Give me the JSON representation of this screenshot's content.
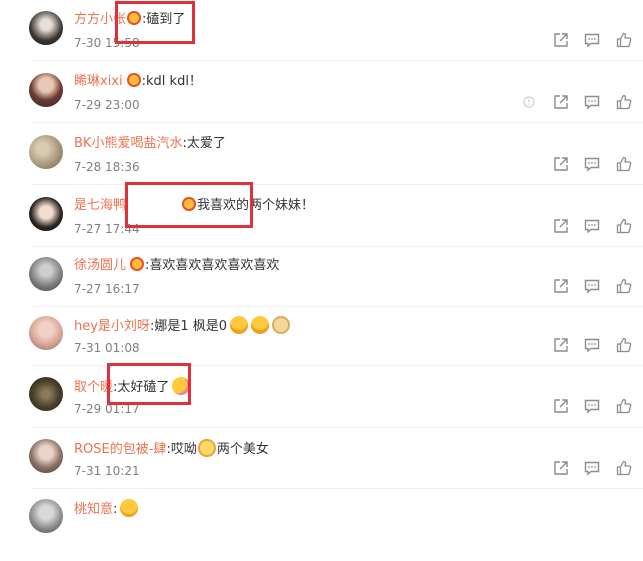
{
  "colors": {
    "username": "#eb7350",
    "text": "#333333",
    "time": "#808080",
    "highlight_box": "#e0303a"
  },
  "action_icons": [
    "share-icon",
    "comment-icon",
    "like-icon"
  ],
  "comments": [
    {
      "username": "方方小张",
      "separator": ":",
      "text": "磕到了",
      "time": "7-30 15:58",
      "emoji_before": "heart-eyes-emoji"
    },
    {
      "username": "睎琳xixi",
      "separator": ":",
      "text": "kdl kdl！",
      "time": "7-29 23:00",
      "emoji_before": "heart-eyes-emoji"
    },
    {
      "username": "BK小熊爱喝盐汽水",
      "separator": ":",
      "text": "太爱了",
      "time": "7-28 18:36"
    },
    {
      "username": "是七海鸭",
      "separator": ":",
      "text": "我喜欢的两个妹妹！",
      "time": "7-27 17:44",
      "emoji_before": "heart-eyes-emoji"
    },
    {
      "username": "徐汤圆儿",
      "separator": ":",
      "text": "喜欢喜欢喜欢喜欢喜欢",
      "time": "7-27 16:17",
      "emoji_before": "heart-eyes-emoji"
    },
    {
      "username": "hey是小刘呀",
      "separator": ":",
      "text": "娜是1 枫是0",
      "time": "7-31 01:08",
      "emoji_after": [
        "shocked-emoji",
        "shocked-emoji",
        "doge-emoji"
      ]
    },
    {
      "username": "取个暖",
      "separator": ":",
      "text": "太好磕了",
      "time": "7-29 01:17",
      "emoji_after": [
        "blush-emoji"
      ]
    },
    {
      "username": "ROSE的包被-肆",
      "separator": ":",
      "text": "哎呦",
      "text_after": "两个美女",
      "time": "7-31 10:21",
      "emoji_middle": "clap-emoji"
    },
    {
      "username": "桃知意",
      "separator": ":",
      "text": "",
      "time": "",
      "emoji_after": [
        "grin-emoji"
      ]
    }
  ]
}
